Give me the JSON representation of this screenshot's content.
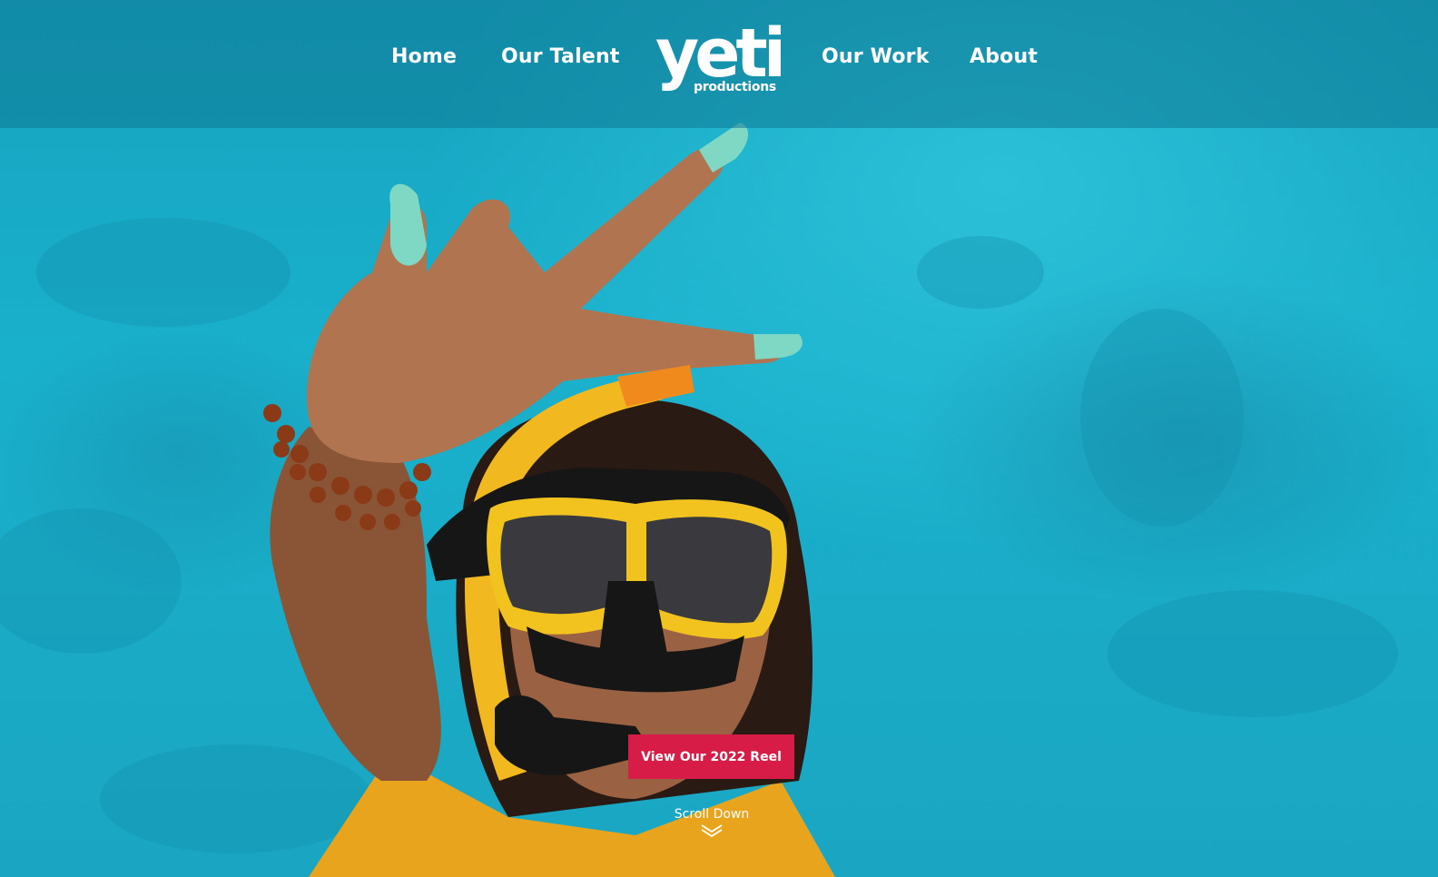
{
  "brand": {
    "logo_main": "yeti",
    "logo_sub": "productions"
  },
  "nav": {
    "home": "Home",
    "talent": "Our Talent",
    "work": "Our Work",
    "about": "About"
  },
  "hero": {
    "cta_label": "View Our 2022 Reel",
    "scroll_label": "Scroll Down",
    "scroll_icon": "double-chevron-down-icon"
  },
  "colors": {
    "accent": "#d81c48",
    "water": "#1aa9c6",
    "header_overlay": "#0e7894"
  }
}
